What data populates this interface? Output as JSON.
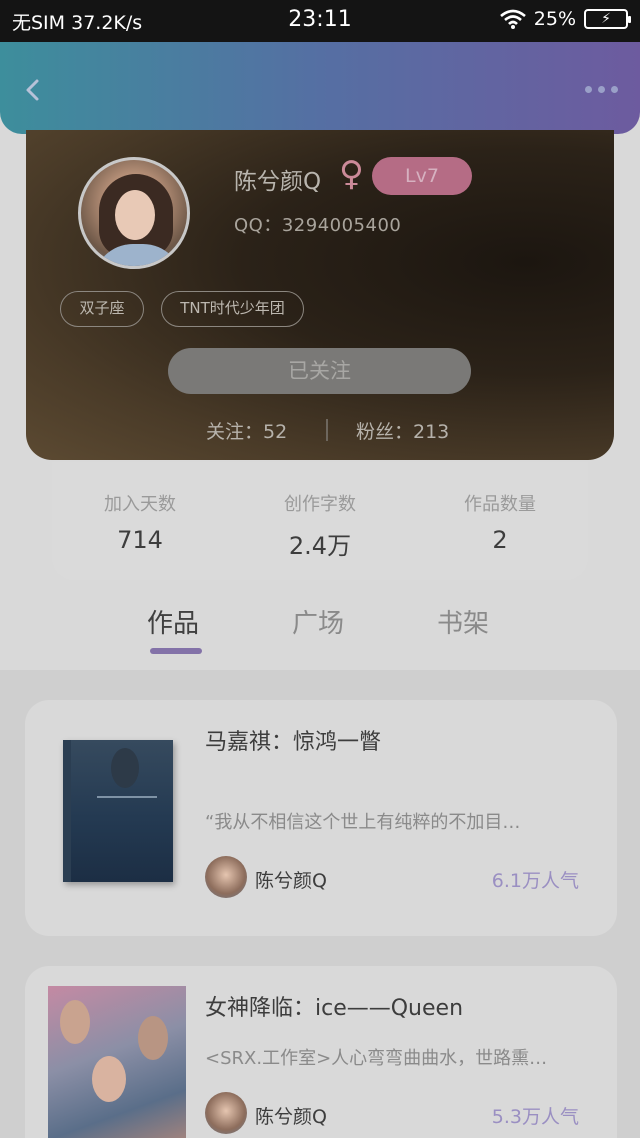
{
  "status_bar": {
    "carrier": "无SIM",
    "speed": "37.2K/s",
    "time": "23:11",
    "battery": "25%"
  },
  "header": {
    "back_icon": "chevron-left-icon",
    "more_icon": "more-dots-icon"
  },
  "profile": {
    "username": "陈兮颜Q",
    "gender_symbol": "♀",
    "level": "Lv7",
    "qq": "QQ：3294005400",
    "tags": [
      "双子座",
      "TNT时代少年团"
    ],
    "follow_button": "已关注",
    "following": "关注：52",
    "fans": "粉丝：213"
  },
  "stats": [
    {
      "label": "加入天数",
      "value": "714"
    },
    {
      "label": "创作字数",
      "value": "2.4万"
    },
    {
      "label": "作品数量",
      "value": "2"
    }
  ],
  "tabs": [
    {
      "label": "作品",
      "active": true
    },
    {
      "label": "广场",
      "active": false
    },
    {
      "label": "书架",
      "active": false
    }
  ],
  "works": [
    {
      "title": "马嘉祺：惊鸿一瞥",
      "desc": "“我从不相信这个世上有纯粹的不加目…",
      "author": "陈兮颜Q",
      "popularity": "6.1万人气"
    },
    {
      "title": "女神降临：ice——Queen",
      "desc": "<SRX.工作室>人心弯弯曲曲水，世路熏…",
      "author": "陈兮颜Q",
      "popularity": "5.3万人气"
    }
  ],
  "colors": {
    "accent": "#8372a8",
    "header_start": "#3d8e9c",
    "header_end": "#6d5b9f",
    "level_badge": "#b56c85",
    "popularity": "#9a8fc2"
  }
}
